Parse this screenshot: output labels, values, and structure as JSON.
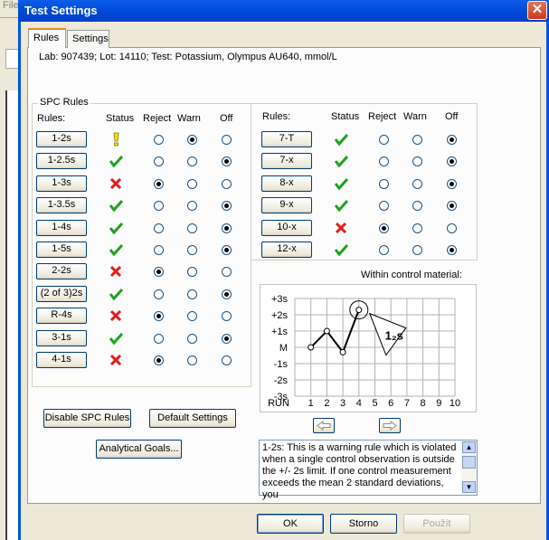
{
  "background_app": {
    "menu_text": "File"
  },
  "window": {
    "title": "Test Settings",
    "close_label": "✕"
  },
  "tabs": [
    {
      "label": "Rules"
    },
    {
      "label": "Settings"
    }
  ],
  "info_line": "Lab:  907439; Lot:  14110; Test:  Potassium, Olympus AU640, mmol/L",
  "spc_group": {
    "label": "SPC Rules"
  },
  "headers": {
    "rules": "Rules:",
    "status": "Status",
    "reject": "Reject",
    "warn": "Warn",
    "off": "Off"
  },
  "left_rules": [
    {
      "label": "1-2s",
      "status": "warning",
      "selected": "warn"
    },
    {
      "label": "1-2.5s",
      "status": "ok",
      "selected": "off"
    },
    {
      "label": "1-3s",
      "status": "error",
      "selected": "reject"
    },
    {
      "label": "1-3.5s",
      "status": "ok",
      "selected": "off"
    },
    {
      "label": "1-4s",
      "status": "ok",
      "selected": "off"
    },
    {
      "label": "1-5s",
      "status": "ok",
      "selected": "off"
    },
    {
      "label": "2-2s",
      "status": "error",
      "selected": "reject"
    },
    {
      "label": "(2 of 3)2s",
      "status": "ok",
      "selected": "off"
    },
    {
      "label": "R-4s",
      "status": "error",
      "selected": "reject"
    },
    {
      "label": "3-1s",
      "status": "ok",
      "selected": "off"
    },
    {
      "label": "4-1s",
      "status": "error",
      "selected": "reject"
    }
  ],
  "right_rules": [
    {
      "label": "7-T",
      "status": "ok",
      "selected": "off"
    },
    {
      "label": "7-x",
      "status": "ok",
      "selected": "off"
    },
    {
      "label": "8-x",
      "status": "ok",
      "selected": "off"
    },
    {
      "label": "9-x",
      "status": "ok",
      "selected": "off"
    },
    {
      "label": "10-x",
      "status": "error",
      "selected": "reject"
    },
    {
      "label": "12-x",
      "status": "ok",
      "selected": "off"
    }
  ],
  "within_label": "Within control material:",
  "chart_data": {
    "type": "line",
    "y_tick_labels": [
      "+3s",
      "+2s",
      "+1s",
      "M",
      "-1s",
      "-2s",
      "-3s"
    ],
    "x_tick_labels": [
      "RUN",
      "1",
      "2",
      "3",
      "4",
      "5",
      "6",
      "7",
      "8",
      "9",
      "10"
    ],
    "x": [
      1,
      2,
      3,
      4
    ],
    "y": [
      0,
      1,
      -0.3,
      2.3
    ],
    "ylim": [
      -3,
      3
    ],
    "annotation": "1₂s",
    "grid": true
  },
  "nav": {
    "prev_icon": "left-arrow-icon",
    "next_icon": "right-arrow-icon"
  },
  "description": "1-2s: This is a warning rule which is violated when a single control observation is outside the +/- 2s limit. If one control measurement exceeds the mean 2 standard deviations, you",
  "buttons": {
    "disable_spc": "Disable SPC Rules",
    "default_settings": "Default Settings",
    "analytical_goals": "Analytical Goals...",
    "ok": "OK",
    "storno": "Storno",
    "pouzit": "Použít"
  },
  "colors": {
    "ok": "#21a121",
    "error": "#e31b1b",
    "warning": "#f5e400",
    "titlebar": "#0054e3"
  }
}
